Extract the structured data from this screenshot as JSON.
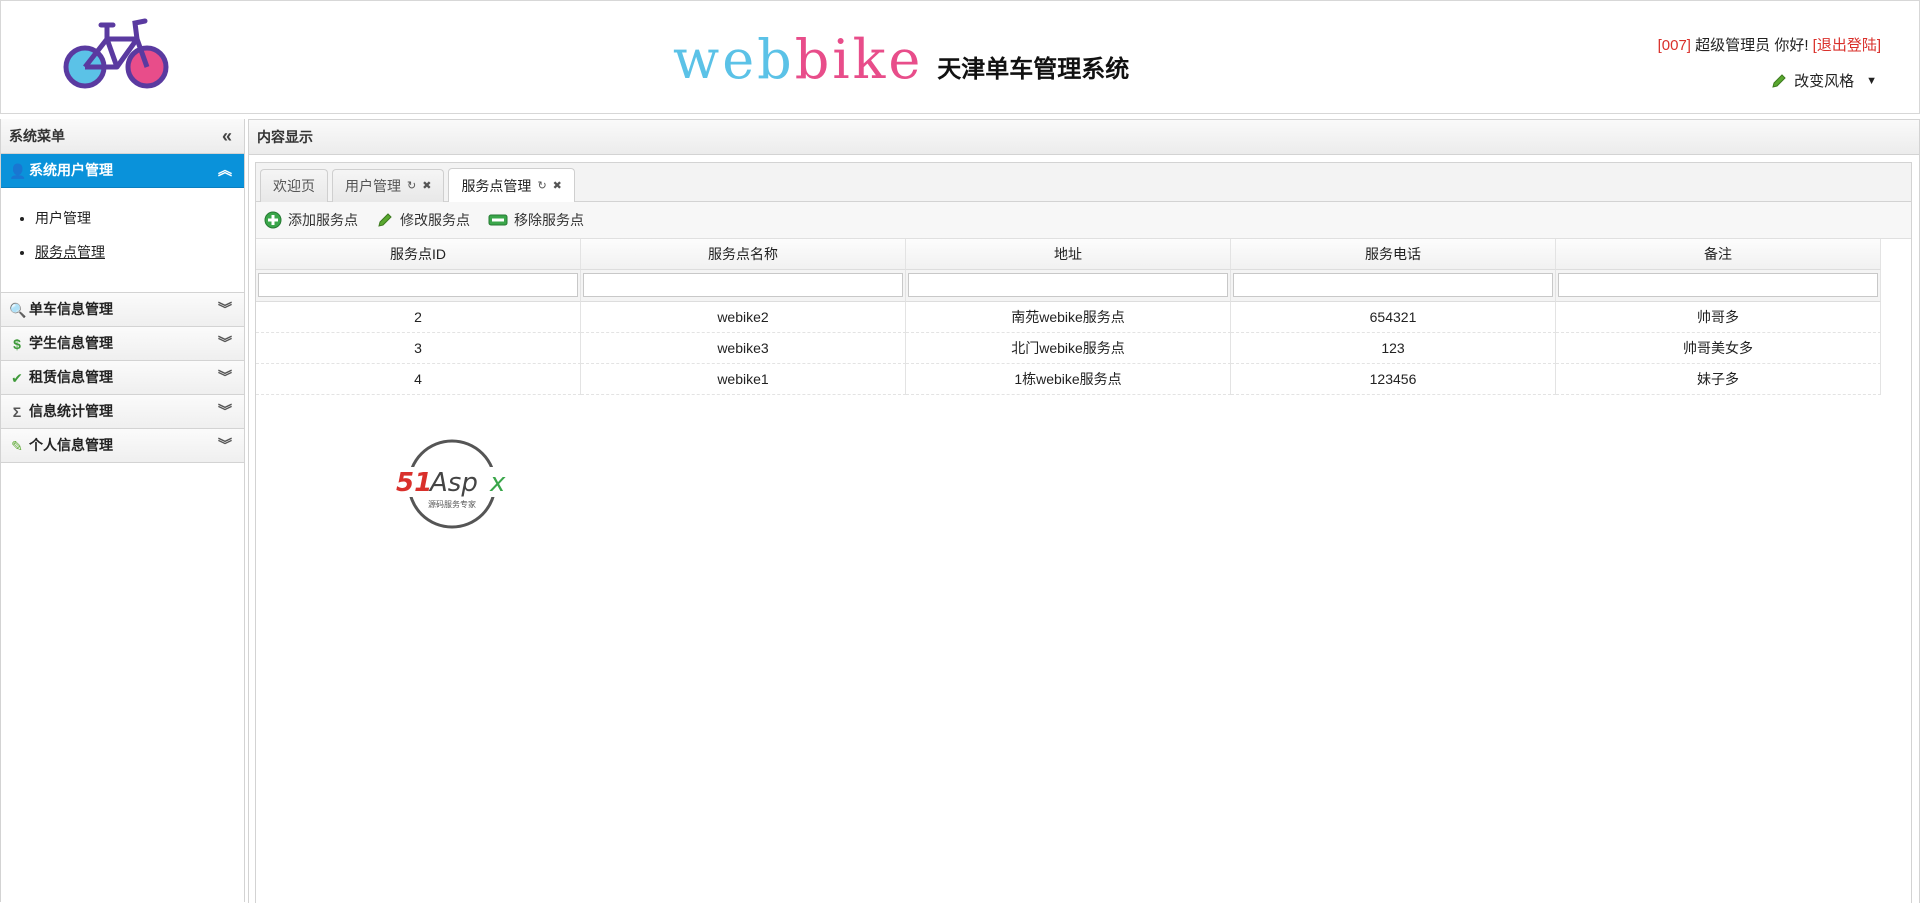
{
  "header": {
    "brand_web": "web",
    "brand_bike": "ike",
    "brand_bike_i": "b",
    "subtitle": "天津单车管理系统",
    "user_id": "[007]",
    "greeting": " 超级管理员 你好! ",
    "logout": "[退出登陆]",
    "style_switch": "改变风格"
  },
  "sidebar": {
    "title": "系统菜单",
    "sections": [
      {
        "label": "系统用户管理",
        "icon": "user-icon",
        "active": true,
        "items": [
          {
            "label": "用户管理"
          },
          {
            "label": "服务点管理"
          }
        ]
      },
      {
        "label": "单车信息管理",
        "icon": "magnifier-icon"
      },
      {
        "label": "学生信息管理",
        "icon": "money-icon"
      },
      {
        "label": "租赁信息管理",
        "icon": "check-icon"
      },
      {
        "label": "信息统计管理",
        "icon": "sigma-icon"
      },
      {
        "label": "个人信息管理",
        "icon": "pencil-icon"
      }
    ]
  },
  "content": {
    "title": "内容显示",
    "tabs": [
      {
        "label": "欢迎页"
      },
      {
        "label": "用户管理"
      },
      {
        "label": "服务点管理",
        "active": true
      }
    ],
    "toolbar": {
      "add": "添加服务点",
      "edit": "修改服务点",
      "remove": "移除服务点"
    },
    "grid": {
      "columns": [
        "服务点ID",
        "服务点名称",
        "地址",
        "服务电话",
        "备注"
      ],
      "rows": [
        [
          "2",
          "webike2",
          "南苑webike服务点",
          "654321",
          "帅哥多"
        ],
        [
          "3",
          "webike3",
          "北门webike服务点",
          "123",
          "帅哥美女多"
        ],
        [
          "4",
          "webike1",
          "1栋webike服务点",
          "123456",
          "妹子多"
        ]
      ]
    },
    "watermark": {
      "brand": "51Aspx",
      "tagline": "源码服务专家"
    }
  },
  "colors": {
    "accent": "#0a92da",
    "brand_blue": "#5bc2e7",
    "brand_pink": "#e84d8a",
    "logout_red": "#d9302b"
  }
}
